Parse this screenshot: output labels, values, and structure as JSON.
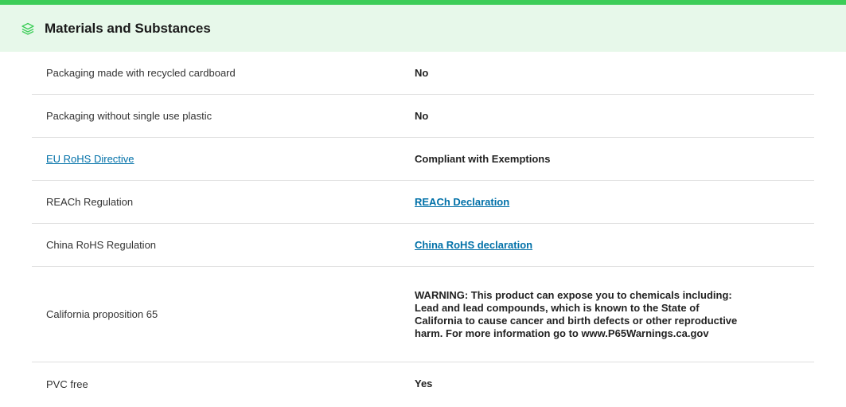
{
  "header": {
    "title": "Materials and Substances",
    "icon": "layers-icon",
    "accent_color": "#3dcd58",
    "background_color": "#e7f8ea"
  },
  "rows": [
    {
      "label": "Packaging made with recycled cardboard",
      "label_is_link": false,
      "value": "No",
      "value_is_link": false
    },
    {
      "label": "Packaging without single use plastic",
      "label_is_link": false,
      "value": "No",
      "value_is_link": false
    },
    {
      "label": "EU RoHS Directive",
      "label_is_link": true,
      "value": "Compliant with Exemptions",
      "value_is_link": false
    },
    {
      "label": "REACh Regulation",
      "label_is_link": false,
      "value": "REACh Declaration",
      "value_is_link": true
    },
    {
      "label": "China RoHS Regulation",
      "label_is_link": false,
      "value": "China RoHS declaration",
      "value_is_link": true
    },
    {
      "label": "California proposition 65",
      "label_is_link": false,
      "value": "WARNING: This product can expose you to chemicals including: Lead and lead compounds, which is known to the State of California to cause cancer and birth defects or other reproductive harm. For more information go to www.P65Warnings.ca.gov",
      "value_is_link": false
    },
    {
      "label": "PVC free",
      "label_is_link": false,
      "value": "Yes",
      "value_is_link": false
    }
  ],
  "link_color": "#0070a8"
}
